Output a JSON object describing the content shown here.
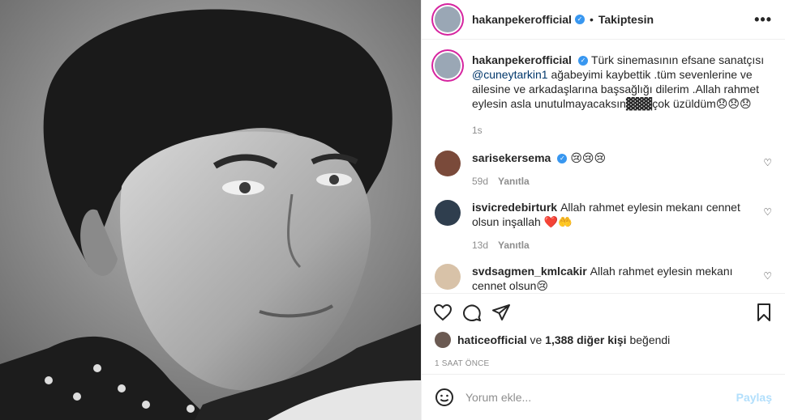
{
  "header": {
    "username": "hakanpekerofficial",
    "follow_state": "Takiptesin",
    "more_label": "•••"
  },
  "caption": {
    "username": "hakanpekerofficial",
    "text_1": "Türk sinemasının efsane sanatçısı ",
    "mention": "@cuneytarkin1",
    "text_2": " ağabeyimi kaybettik .tüm sevenlerine ve ailesine ve arkadaşlarına başsağlığı dilerim .Allah rahmet eylesin asla unutulmayacaksın",
    "blocks": "▓▓▓",
    "text_3": "çok üzüldüm",
    "emojis": "😞😞😞",
    "time": "1s"
  },
  "comments": [
    {
      "username": "sarisekersema",
      "verified": true,
      "text": "",
      "emojis": "😢😢😢",
      "time": "59d",
      "reply": "Yanıtla"
    },
    {
      "username": "isvicredebirturk",
      "verified": false,
      "text": "Allah rahmet eylesin mekanı cennet olsun inşallah",
      "emojis": "❤️🤲",
      "time": "13d",
      "reply": "Yanıtla"
    },
    {
      "username": "svdsagmen_kmlcakir",
      "verified": false,
      "text": "Allah rahmet eylesin mekanı cennet olsun",
      "emojis": "😢",
      "time": "",
      "reply": ""
    }
  ],
  "likes": {
    "liker": "haticeofficial",
    "connector": " ve ",
    "others": "1,388 diğer kişi",
    "suffix": " beğendi"
  },
  "posted_ago": "1 SAAT ÖNCE",
  "add_comment": {
    "placeholder": "Yorum ekle...",
    "post_label": "Paylaş"
  },
  "colors": {
    "verified": "#3897f0",
    "mention": "#00376b",
    "muted": "#8e8e8e",
    "post_disabled": "#b2dffc",
    "heart_red": "#ed4956"
  },
  "icons": [
    "heart-icon",
    "comment-icon",
    "share-icon",
    "bookmark-icon",
    "emoji-icon",
    "more-icon",
    "verified-icon"
  ]
}
